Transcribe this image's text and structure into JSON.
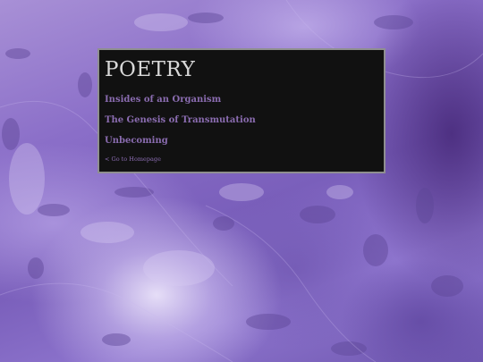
{
  "page": {
    "title": "POETRY"
  },
  "poems": [
    {
      "label": "Insides of an Organism"
    },
    {
      "label": "The Genesis of Transmutation"
    },
    {
      "label": "Unbecoming"
    }
  ],
  "back_link": {
    "label": "< Go to Homepage"
  },
  "colors": {
    "panel_background": "#111111",
    "panel_border": "#8f8f8f",
    "title": "#d8d8d8",
    "link": "#8a6cb0",
    "background_accent": "#8a6ec8"
  }
}
